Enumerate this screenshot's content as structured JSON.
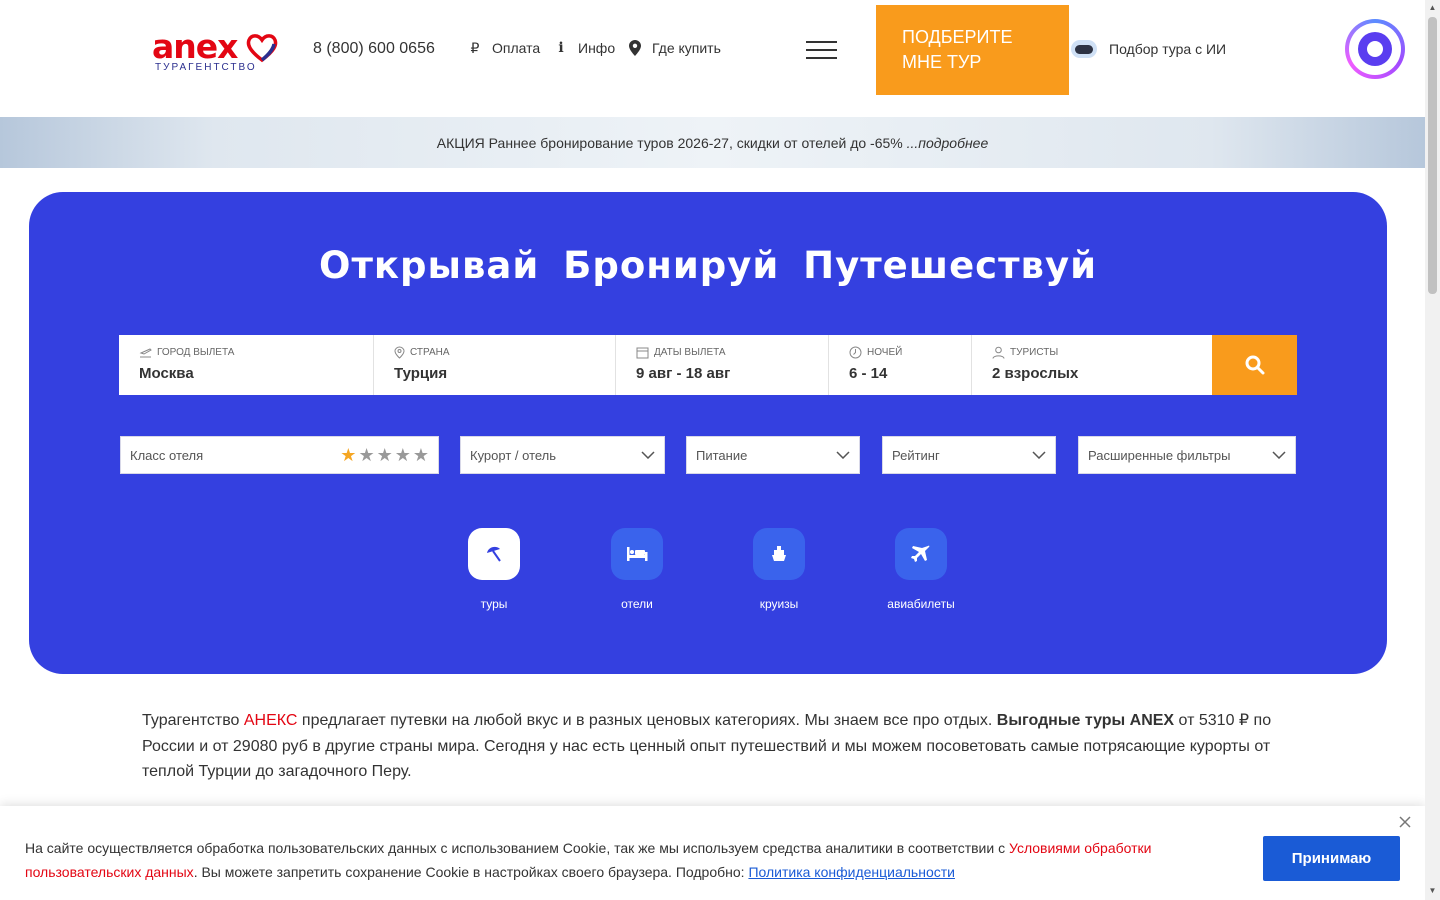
{
  "header": {
    "logo_word": "anex",
    "logo_sub": "ТУРАГЕНТСТВО",
    "phone": "8 (800) 600 0656",
    "nav": [
      {
        "label": "Оплата",
        "icon": "ruble-icon"
      },
      {
        "label": "Инфо",
        "icon": "info-icon"
      },
      {
        "label": "Где купить",
        "icon": "location-pin-icon"
      }
    ],
    "cta": "Подберите мне тур",
    "ai_link": "Подбор тура с ИИ"
  },
  "promo": {
    "text": "АКЦИЯ Раннее бронирование туров 2026-27, скидки от отелей до -65%",
    "more": "...подробнее"
  },
  "hero": {
    "title": "Открывай  Бронируй  Путешествуй",
    "search": {
      "departure": {
        "label": "Город вылета",
        "value": "Москва"
      },
      "country": {
        "label": "Страна",
        "value": "Турция"
      },
      "dates": {
        "label": "Даты вылета",
        "value": "9 авг - 18 авг"
      },
      "nights": {
        "label": "Ночей",
        "value": "6 - 14"
      },
      "tourists": {
        "label": "Туристы",
        "value": "2 взрослых"
      }
    },
    "filters": {
      "hotel_class": "Класс отеля",
      "hotel_class_stars": 1,
      "resort": "Курорт / отель",
      "meal": "Питание",
      "rating": "Рейтинг",
      "advanced": "Расширенные фильтры"
    },
    "categories": [
      {
        "label": "туры",
        "icon": "beach-umbrella-icon",
        "active": true
      },
      {
        "label": "отели",
        "icon": "bed-icon",
        "active": false
      },
      {
        "label": "круизы",
        "icon": "ship-icon",
        "active": false
      },
      {
        "label": "авиабилеты",
        "icon": "airplane-icon",
        "active": false
      }
    ]
  },
  "intro": {
    "part1": "Турагентство ",
    "brand": "АНЕКС",
    "part2": " предлагает путевки на любой вкус и в разных ценовых категориях. Мы знаем все про отдых. ",
    "bold": "Выгодные туры ANEX",
    "part3": " от 5310 ₽ по России и от 29080 руб в другие страны мира. Сегодня у нас есть ценный опыт путешествий и мы можем посоветовать самые потрясающие курорты от теплой Турции до загадочного Перу."
  },
  "cookie": {
    "text1": "На сайте осуществляется обработка пользовательских данных с использованием Cookie, так же мы используем средства аналитики в соответствии с ",
    "terms_link": "Условиями обработки пользовательских данных",
    "text2": ". Вы можете запретить сохранение Cookie в настройках своего браузера. Подробно: ",
    "policy_link": "Политика конфиденциальности",
    "accept": "Принимаю"
  },
  "colors": {
    "brand_red": "#e30613",
    "hero_blue": "#3440e0",
    "accent_orange": "#f99b1c",
    "link_blue": "#1a5bd6"
  }
}
